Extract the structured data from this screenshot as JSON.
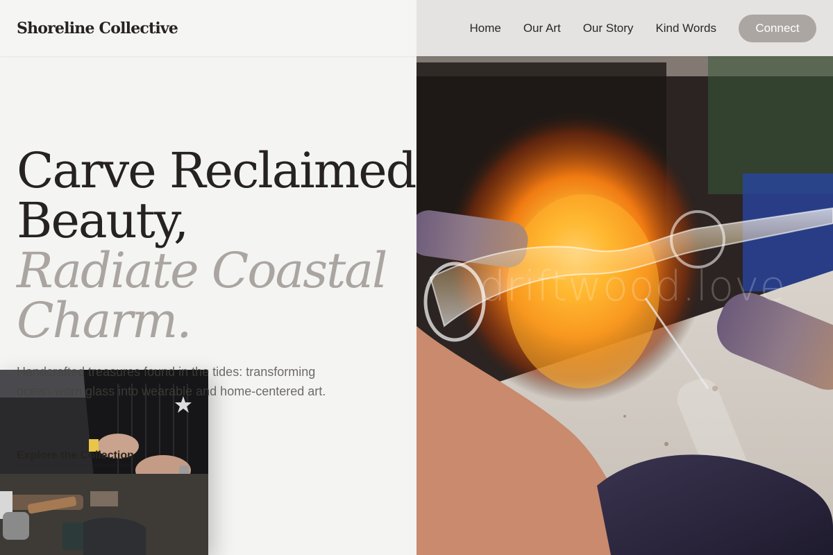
{
  "nav": {
    "brand": "Shoreline Collective",
    "links": [
      "Home",
      "Our Art",
      "Our Story",
      "Kind Words"
    ],
    "cta": "Connect"
  },
  "hero": {
    "headline_line1": "Carve Reclaimed",
    "headline_line2": "Beauty,",
    "accent_line1": "Radiate Coastal",
    "accent_line2": "Charm.",
    "tagline": "Handcrafted treasures found in the tides: transforming ocean-worn glass into wearable and home-centered art.",
    "explore_label": "Explore the Collection",
    "watermark": "driftwood.love"
  },
  "colors": {
    "background": "#f4f4f3",
    "text": "#262220",
    "accent_text": "#aaa5a0",
    "button_bg": "#aba6a1",
    "button_text": "#ffffff"
  }
}
